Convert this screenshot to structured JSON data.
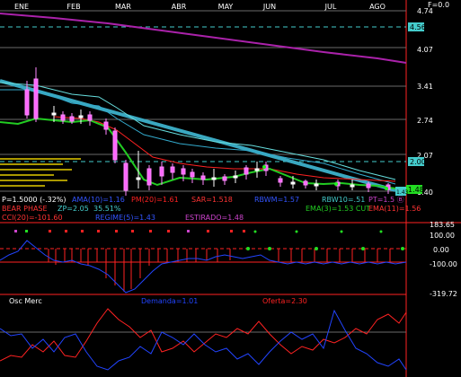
{
  "months": [
    "ENE",
    "FEB",
    "MAR",
    "ABR",
    "MAY",
    "JUN",
    "JUL",
    "AGO"
  ],
  "price_axis": {
    "top_label": "F=0.0",
    "ticks": [
      "4.74",
      "4.07",
      "3.41",
      "2.74",
      "2.07",
      "1.40"
    ],
    "tags": {
      "upper": "4.56",
      "mid": "2.00",
      "last": "1.48",
      "low": "1.43"
    }
  },
  "indicators": {
    "price": "P=1.5000 (-.32%)",
    "ama": "AMA(10)=1.16",
    "pm20": "PM(20)=1.61",
    "sar": "SAR=1.518",
    "rbwm": "RBWM=1.57",
    "rbw10": "RBW10=.51",
    "pt": "PT=1.5 Ⓑ",
    "phase": "BEAR PHASE",
    "zp": "ZP=2.05",
    "pct": "35.51%",
    "ema3": "EMA(3)=1.53 CUT",
    "ema11": "EMA(11)=1.56",
    "cci": "CCI(20)=-101.60",
    "regime": "REGIME(5)=1.43",
    "estirado": "ESTIRADO=1.48"
  },
  "cci_axis": [
    "183.65",
    "100.00",
    "0.00",
    "-100.00",
    "-319.72"
  ],
  "osc": {
    "title": "Osc Merc",
    "demand": "Demanda=1.01",
    "offer": "Oferta=2.30"
  },
  "colors": {
    "background": "#000000",
    "grid": "#5a5a5a",
    "candle": "#ff66ff",
    "green_line": "#22cc22",
    "red_line": "#ff2222",
    "cyan_line": "#44cccc",
    "purple_line": "#aa22aa",
    "blue_line": "#2244ff",
    "tag_cyan": "#44cccc",
    "tag_green": "#22dd22"
  }
}
